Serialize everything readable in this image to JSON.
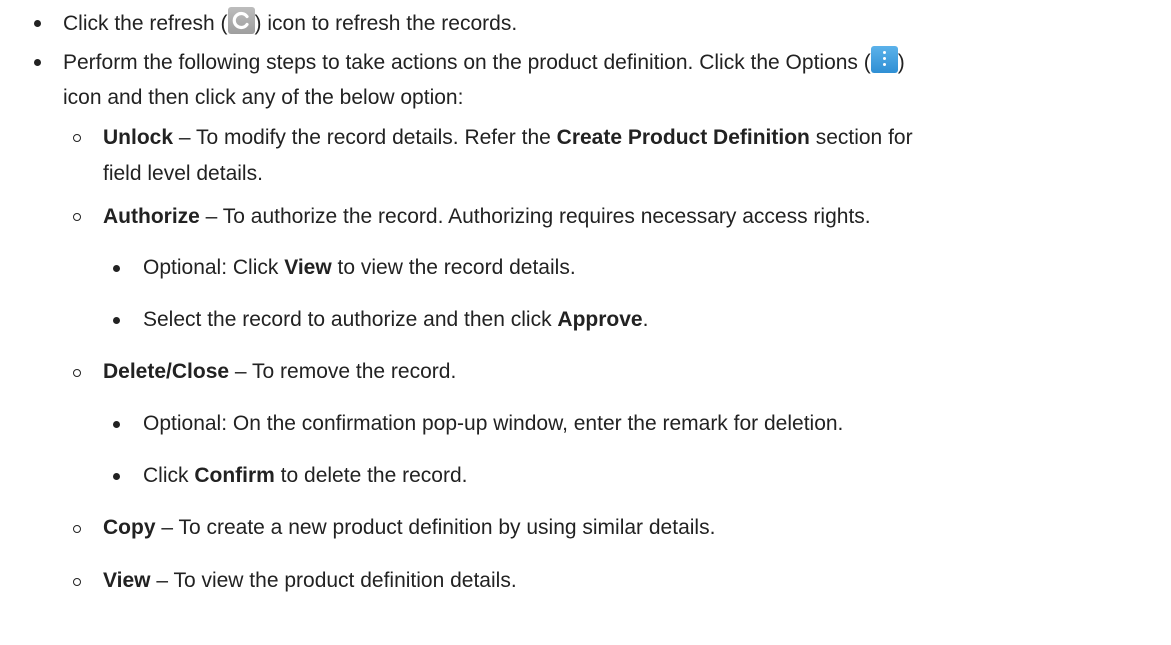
{
  "items": [
    {
      "pre": "Click the refresh (",
      "post": ") icon to refresh the records."
    },
    {
      "line1_pre": "Perform the following steps to take actions on the product definition. Click the Options (",
      "line1_post": ")",
      "line2": "icon and then click any of the below option:"
    },
    {
      "bold": "Unlock",
      "mid": " – To modify the record details. Refer the ",
      "bold2": "Create Product Definition",
      "post": " section for",
      "line2": "field level details."
    },
    {
      "bold": "Authorize",
      "post": " – To authorize the record. Authorizing requires necessary access rights."
    },
    {
      "pre": "Optional: Click ",
      "bold": "View",
      "post": " to view the record details."
    },
    {
      "pre": "Select the record to authorize and then click ",
      "bold": "Approve",
      "post": "."
    },
    {
      "bold": "Delete/Close",
      "post": " – To remove the record."
    },
    {
      "text": "Optional: On the confirmation pop-up window, enter the remark for deletion."
    },
    {
      "pre": "Click ",
      "bold": "Confirm",
      "post": " to delete the record."
    },
    {
      "bold": "Copy",
      "post": " – To create a new product definition by using similar details."
    },
    {
      "bold": "View",
      "post": " – To view the product definition details."
    }
  ],
  "icons": {
    "refresh": "refresh-icon",
    "options": "options-icon"
  },
  "colors": {
    "refresh_icon": "#a8a8a8",
    "options_icon": "#3a9ade"
  }
}
